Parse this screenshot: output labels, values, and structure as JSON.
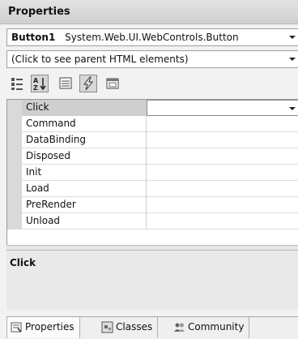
{
  "panel": {
    "title": "Properties"
  },
  "object_selector": {
    "name": "Button1",
    "type": "System.Web.UI.WebControls.Button"
  },
  "element_selector": {
    "label": "(Click to see parent HTML elements)"
  },
  "toolbar": {
    "buttons": [
      {
        "icon": "categorized-icon",
        "pressed": false
      },
      {
        "icon": "alphabetical-icon",
        "pressed": true
      },
      {
        "icon": "properties-icon",
        "pressed": false
      },
      {
        "icon": "events-lightning-icon",
        "pressed": true
      },
      {
        "icon": "property-pages-icon",
        "pressed": false
      }
    ]
  },
  "events": [
    {
      "name": "Click",
      "value": ""
    },
    {
      "name": "Command",
      "value": ""
    },
    {
      "name": "DataBinding",
      "value": ""
    },
    {
      "name": "Disposed",
      "value": ""
    },
    {
      "name": "Init",
      "value": ""
    },
    {
      "name": "Load",
      "value": ""
    },
    {
      "name": "PreRender",
      "value": ""
    },
    {
      "name": "Unload",
      "value": ""
    }
  ],
  "description": {
    "title": "Click"
  },
  "tabs": [
    {
      "label": "Properties",
      "icon": "properties-window-icon",
      "active": true
    },
    {
      "label": "Classes",
      "icon": "class-view-icon",
      "active": false
    },
    {
      "label": "Community",
      "icon": "community-icon",
      "active": false
    }
  ]
}
